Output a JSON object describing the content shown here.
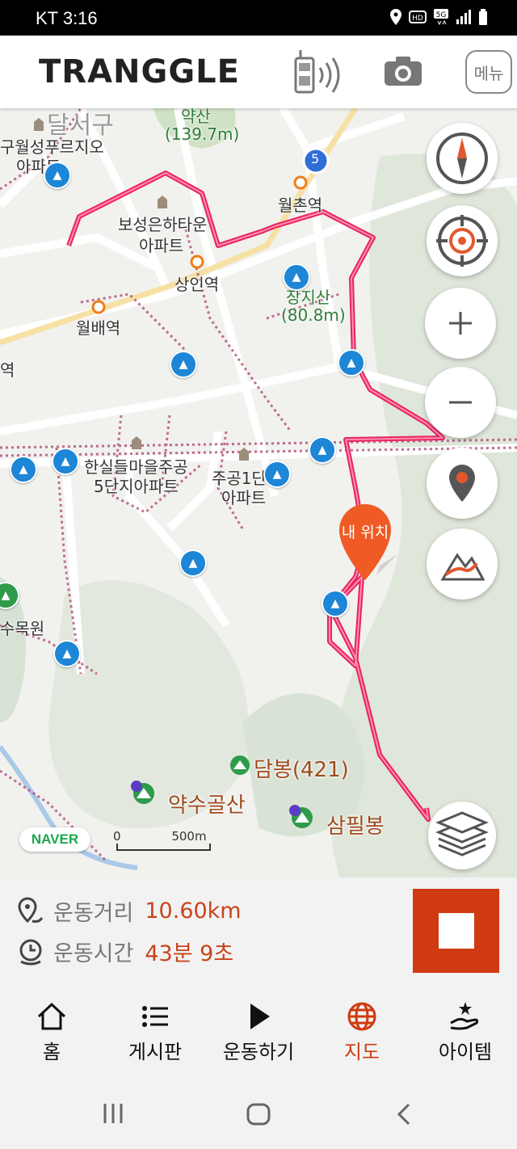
{
  "status_bar": {
    "carrier_time": "KT  3:16",
    "icons": [
      "location-icon",
      "hd-icon",
      "5g-icon",
      "signal-icon",
      "battery-icon"
    ]
  },
  "app": {
    "logo": "TRANGGLE",
    "menu_label": "메뉴"
  },
  "map": {
    "labels": {
      "dalseo": "달서구",
      "yakshan": "약산",
      "yakshan_height": "(139.7m)",
      "guwol_1": "구월성푸르지오",
      "guwol_2": "아파트",
      "wolchon": "월촌역",
      "boseong_1": "보성은하타운",
      "boseong_2": "아파트",
      "sangin": "상인역",
      "jangji": "장지산",
      "jangji_height": "(80.8m)",
      "wolbae": "월배역",
      "yeok": "역",
      "hansil_1": "한실들마을주공",
      "hansil_2": "5단지아파트",
      "jugong_1": "주공1단",
      "jugong_2": "아파트",
      "sumokwon": "수목원",
      "dambong": "담봉(421)",
      "yaksugolsan": "약수골산",
      "sampilbong": "삼필봉",
      "route_badge": "5"
    },
    "my_location_label": "내 위치",
    "naver_logo": "NAVER",
    "scale_zero": "0",
    "scale_label": "500m"
  },
  "stats": {
    "distance_label": "운동거리",
    "distance_value": "10.60km",
    "time_label": "운동시간",
    "time_value": "43분 9초"
  },
  "bottom_nav": [
    {
      "label": "홈",
      "icon": "home-icon"
    },
    {
      "label": "게시판",
      "icon": "list-icon"
    },
    {
      "label": "운동하기",
      "icon": "play-icon"
    },
    {
      "label": "지도",
      "icon": "globe-icon",
      "active": true
    },
    {
      "label": "아이템",
      "icon": "hand-star-icon"
    }
  ],
  "colors": {
    "accent": "#d03a10",
    "track": "#e8235f",
    "poi": "#1d86d6"
  }
}
